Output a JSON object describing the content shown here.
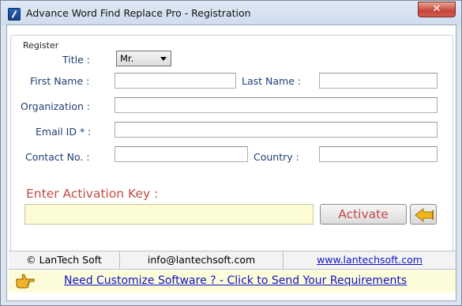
{
  "window": {
    "title": "Advance Word Find Replace Pro - Registration",
    "close_glyph": "✕"
  },
  "form": {
    "legend": "Register",
    "title_label": "Title :",
    "title_value": "Mr.",
    "first_name_label": "First Name :",
    "first_name_value": "",
    "last_name_label": "Last Name :",
    "last_name_value": "",
    "organization_label": "Organization :",
    "organization_value": "",
    "email_label": "Email ID * :",
    "email_value": "",
    "contact_label": "Contact No. :",
    "contact_value": "",
    "country_label": "Country :",
    "country_value": ""
  },
  "activation": {
    "label": "Enter Activation Key  :",
    "value": "",
    "button_label": "Activate"
  },
  "footer": {
    "company": "© LanTech Soft",
    "email": "info@lantechsoft.com",
    "website": "www.lantechsoft.com"
  },
  "banner": {
    "text": "Need Customize Software ? - Click to Send Your Requirements"
  },
  "colors": {
    "label_blue": "#1f3f73",
    "activation_red": "#c24a46",
    "link_blue": "#1212c8",
    "banner_bg": "#fcfcd8",
    "key_input_bg": "#fcfcd4"
  }
}
